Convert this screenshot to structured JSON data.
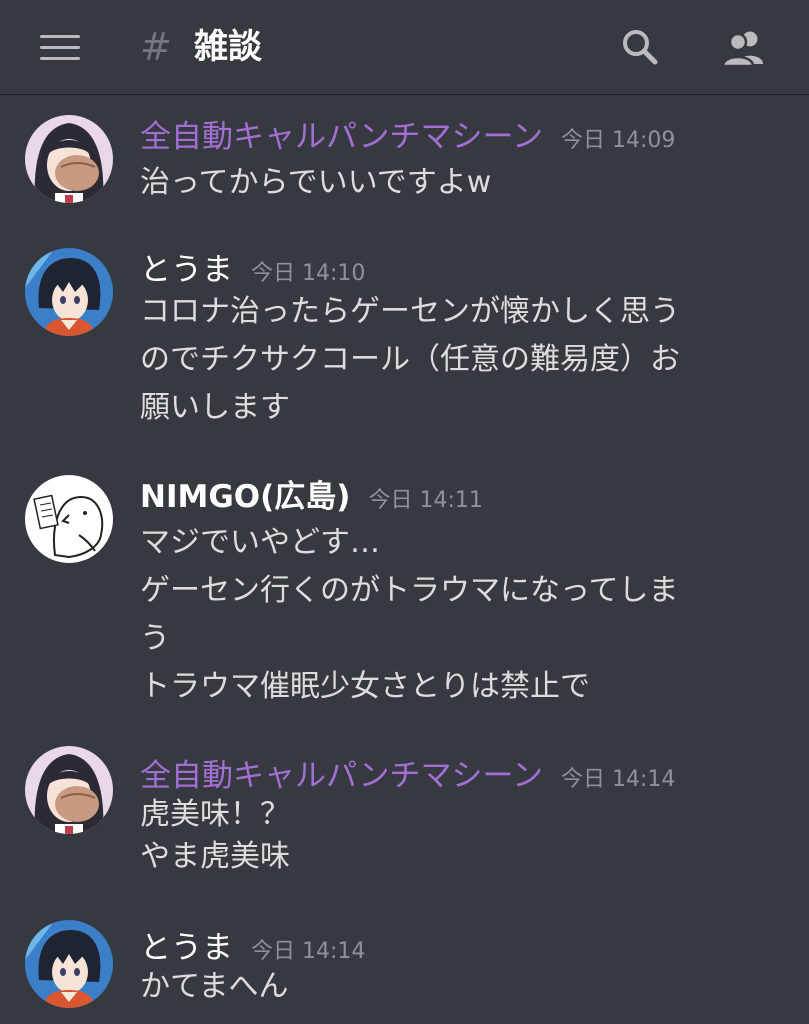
{
  "header": {
    "hash": "#",
    "channel_name": "雑談",
    "menu_icon": "hamburger-menu-icon",
    "search_icon": "search-icon",
    "members_icon": "members-icon"
  },
  "colors": {
    "background": "#36393f",
    "username_purple": "#a26fd4",
    "text": "#dcddde",
    "timestamp": "#8e9297"
  },
  "messages": [
    {
      "author": "全自動キャルパンチマシーン",
      "timestamp": "今日 14:09",
      "lines": [
        "治ってからでいいですよw"
      ]
    },
    {
      "author": "とうま",
      "timestamp": "今日 14:10",
      "lines": [
        "コロナ治ったらゲーセンが懐かしく思う",
        "のでチクサクコール（任意の難易度）お",
        "願いします"
      ]
    },
    {
      "author": "NIMGO(広島)",
      "timestamp": "今日 14:11",
      "lines": [
        "マジでいやどす…",
        "ゲーセン行くのがトラウマになってしま",
        "う",
        "トラウマ催眠少女さとりは禁止で"
      ]
    },
    {
      "author": "全自動キャルパンチマシーン",
      "timestamp": "今日 14:14",
      "lines": [
        "虎美味！？",
        "やま虎美味"
      ]
    },
    {
      "author": "とうま",
      "timestamp": "今日 14:14",
      "lines": [
        "かてまへん"
      ]
    }
  ]
}
